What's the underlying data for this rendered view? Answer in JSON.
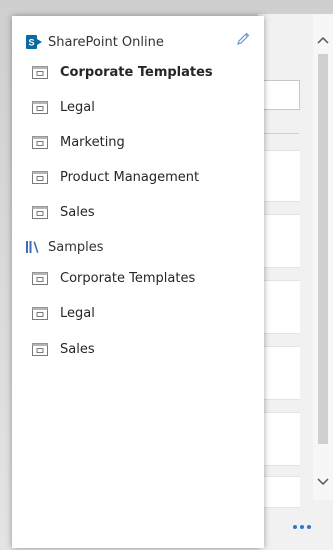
{
  "panel": {
    "groups": [
      {
        "name": "SharePoint Online",
        "icon": "sharepoint-icon",
        "items": [
          {
            "label": "Corporate Templates",
            "icon": "library-folder-icon",
            "selected": true
          },
          {
            "label": "Legal",
            "icon": "library-folder-icon"
          },
          {
            "label": "Marketing",
            "icon": "library-folder-icon"
          },
          {
            "label": "Product Management",
            "icon": "library-folder-icon"
          },
          {
            "label": "Sales",
            "icon": "library-folder-icon"
          }
        ]
      },
      {
        "name": "Samples",
        "icon": "books-icon",
        "items": [
          {
            "label": "Corporate Templates",
            "icon": "library-folder-icon"
          },
          {
            "label": "Legal",
            "icon": "library-folder-icon"
          },
          {
            "label": "Sales",
            "icon": "library-folder-icon"
          }
        ]
      }
    ],
    "edit_icon": "pencil-icon"
  },
  "background": {
    "scroll_up_icon": "chevron-up-icon",
    "scroll_down_icon": "chevron-down-icon",
    "more_icon": "ellipsis-icon"
  },
  "colors": {
    "sharepoint": "#0b6aa2",
    "accent": "#2b78d0",
    "text": "#262626"
  }
}
